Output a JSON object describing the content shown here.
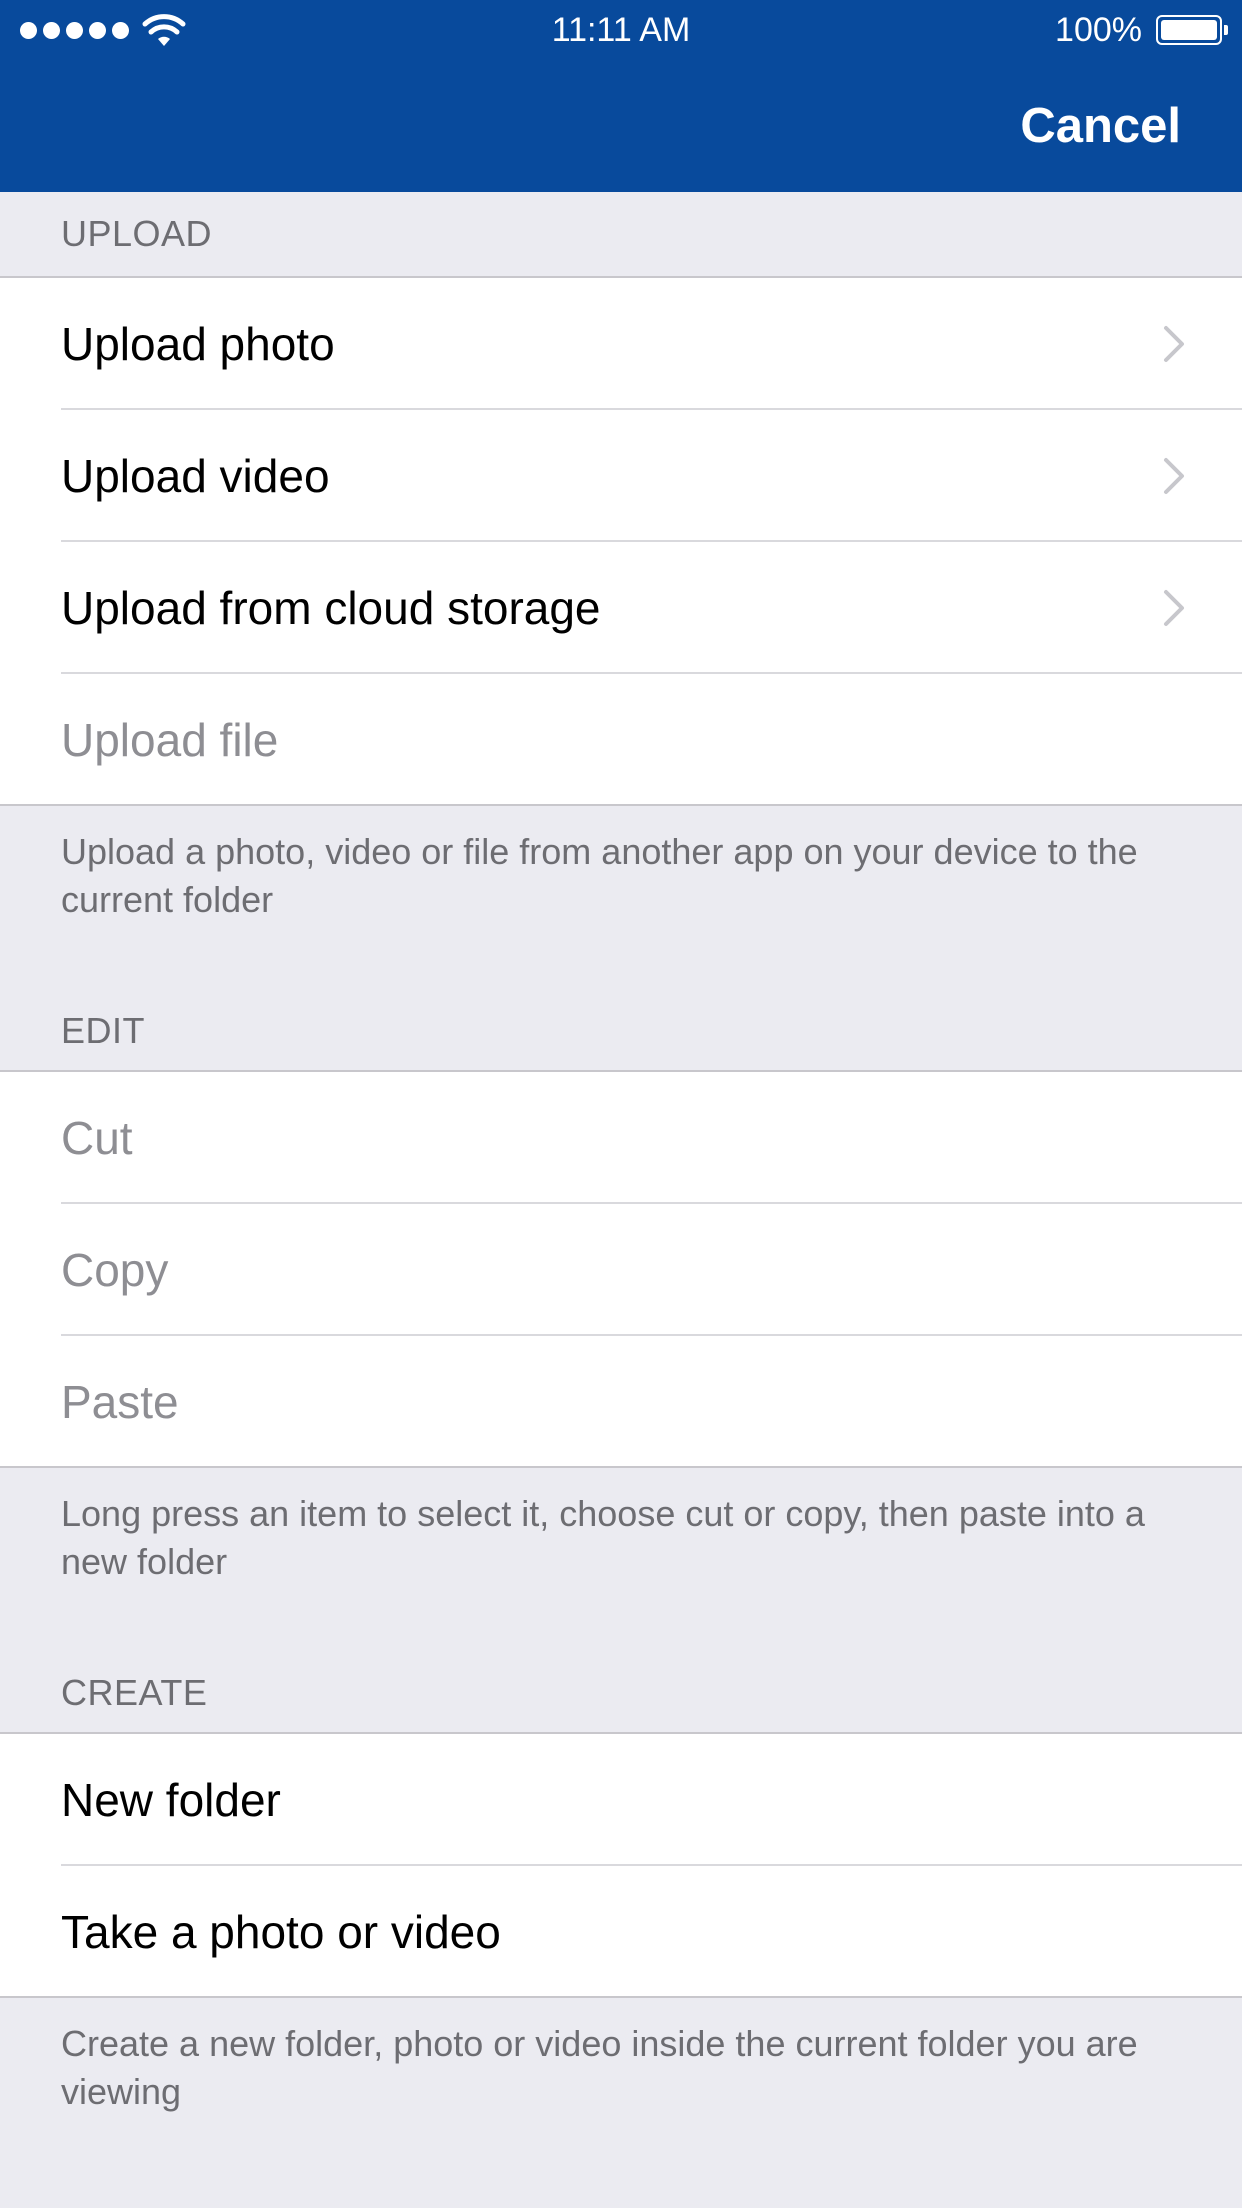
{
  "status_bar": {
    "time": "11:11 AM",
    "battery_percent": "100%"
  },
  "navbar": {
    "cancel_label": "Cancel"
  },
  "sections": {
    "upload": {
      "header": "UPLOAD",
      "items": [
        {
          "label": "Upload photo",
          "enabled": true,
          "chevron": true
        },
        {
          "label": "Upload video",
          "enabled": true,
          "chevron": true
        },
        {
          "label": "Upload from cloud storage",
          "enabled": true,
          "chevron": true
        },
        {
          "label": "Upload file",
          "enabled": false,
          "chevron": false
        }
      ],
      "footer": "Upload a photo, video or file from another app on your device to the current folder"
    },
    "edit": {
      "header": "EDIT",
      "items": [
        {
          "label": "Cut",
          "enabled": false
        },
        {
          "label": "Copy",
          "enabled": false
        },
        {
          "label": "Paste",
          "enabled": false
        }
      ],
      "footer": "Long press an item to select it, choose cut or copy, then paste into a new folder"
    },
    "create": {
      "header": "CREATE",
      "items": [
        {
          "label": "New folder",
          "enabled": true
        },
        {
          "label": "Take a photo or video",
          "enabled": true
        }
      ],
      "footer": "Create a new folder, photo or video inside the current folder you are viewing"
    }
  },
  "colors": {
    "navbar": "#084A9C",
    "background": "#EBEBF1",
    "disabled_text": "#8E8E93",
    "section_text": "#6D6D72"
  },
  "icons": [
    "signal-dots-icon",
    "wifi-icon",
    "battery-icon",
    "chevron-right-icon"
  ]
}
